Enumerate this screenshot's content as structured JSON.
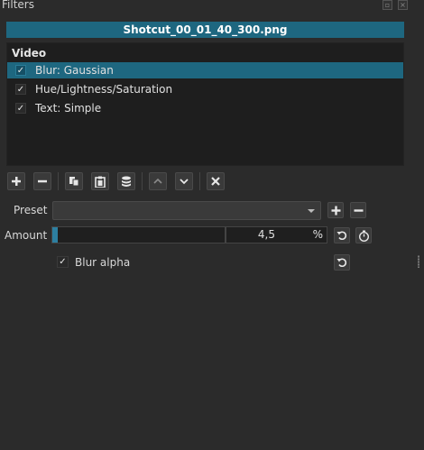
{
  "panel": {
    "title": "Filters"
  },
  "file": {
    "name": "Shotcut_00_01_40_300.png"
  },
  "filter_list": {
    "header": "Video",
    "items": [
      {
        "label": "Blur: Gaussian",
        "checked": true,
        "selected": true
      },
      {
        "label": "Hue/Lightness/Saturation",
        "checked": true,
        "selected": false
      },
      {
        "label": "Text: Simple",
        "checked": true,
        "selected": false
      }
    ]
  },
  "toolbar": {
    "buttons": [
      "add-icon",
      "remove-icon",
      "copy-icon",
      "paste-icon",
      "save-preset-icon",
      "move-up-icon",
      "move-down-icon",
      "deselect-icon"
    ]
  },
  "preset": {
    "label": "Preset",
    "value": ""
  },
  "amount": {
    "label": "Amount",
    "value": "4,5",
    "suffix": "%",
    "fill_fraction": 0.02
  },
  "blur_alpha": {
    "label": "Blur alpha",
    "checked": true
  },
  "colors": {
    "accent": "#1e6780",
    "background": "#2b2b2b"
  }
}
